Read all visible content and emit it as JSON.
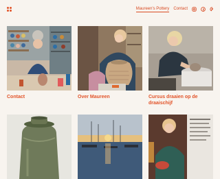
{
  "nav": {
    "items": [
      {
        "label": "Maureen's Pottery",
        "active": true
      },
      {
        "label": "Contact",
        "active": false
      }
    ],
    "icons": [
      "instagram-icon",
      "facebook-icon",
      "pinterest-icon"
    ]
  },
  "tiles": [
    {
      "caption": "Contact"
    },
    {
      "caption": "Over Maureen"
    },
    {
      "caption": "Cursus draaien op de draaischijf"
    },
    {
      "caption": ""
    },
    {
      "caption": ""
    },
    {
      "caption": ""
    }
  ],
  "colors": {
    "accent": "#e2542a",
    "background": "#f8f4ef"
  }
}
